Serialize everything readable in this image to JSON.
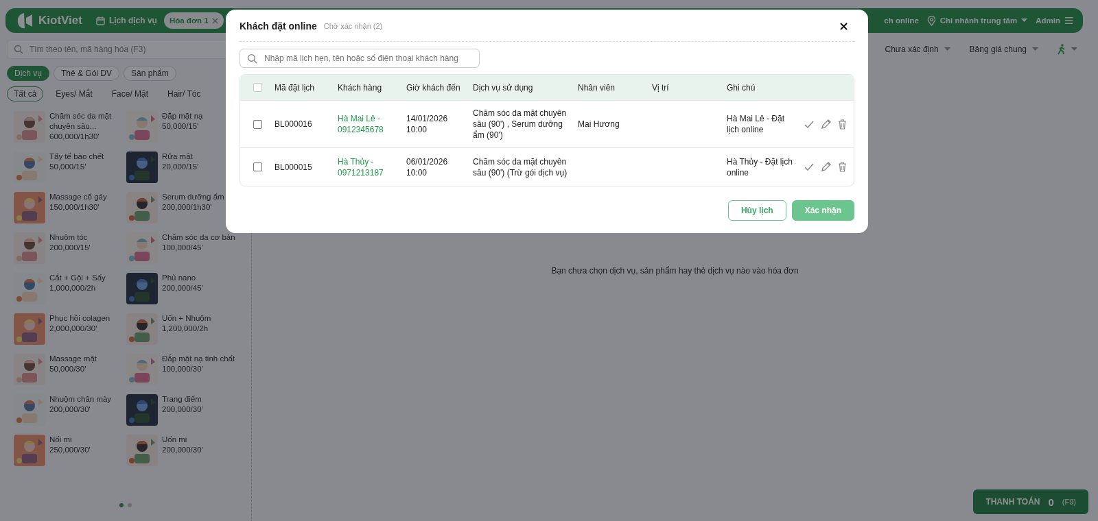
{
  "header": {
    "logo": "KiotViet",
    "nav": [
      {
        "label": "Lịch dịch vụ",
        "kind": "calendar",
        "selected": false
      },
      {
        "label": "Hóa đơn 1",
        "kind": "tab",
        "selected": true
      }
    ],
    "right": [
      {
        "label": "ch online",
        "kind": "text"
      },
      {
        "label": "Chi nhánh trung tâm",
        "kind": "branch"
      },
      {
        "label": "Admin",
        "kind": "menu"
      }
    ]
  },
  "search": {
    "placeholder": "Tìm theo tên, mã hàng hóa (F3)"
  },
  "categories": [
    {
      "label": "Dịch vụ",
      "selected": true
    },
    {
      "label": "Thẻ & Gói DV",
      "selected": false
    },
    {
      "label": "Sản phẩm",
      "selected": false
    }
  ],
  "filters": [
    {
      "label": "Tất cả",
      "selected": true
    },
    {
      "label": "Eyes/ Mắt",
      "selected": false
    },
    {
      "label": "Face/ Mặt",
      "selected": false
    },
    {
      "label": "Hair/ Tóc",
      "selected": false
    }
  ],
  "products": [
    {
      "name": "Chăm sóc da mặt chuyên sâu...",
      "price": "600,000/1h30'"
    },
    {
      "name": "Đắp mặt nạ",
      "price": "50,000/15'"
    },
    {
      "name": "Tẩy tế bào chết",
      "price": "50,000/15'"
    },
    {
      "name": "Rửa mặt",
      "price": "20,000/15'"
    },
    {
      "name": "Massage cổ gáy",
      "price": "150,000/1h30'"
    },
    {
      "name": "Serum dưỡng ẩm",
      "price": "200,000/1h30'"
    },
    {
      "name": "Nhuộm tóc",
      "price": "200,000/15'"
    },
    {
      "name": "Chăm sóc da cơ bản",
      "price": "100,000/45'"
    },
    {
      "name": "Cắt + Gội + Sấy",
      "price": "1,000,000/2h"
    },
    {
      "name": "Phủ nano",
      "price": "200,000/45'"
    },
    {
      "name": "Phục hồi colagen",
      "price": "2,000,000/30'"
    },
    {
      "name": "Uốn + Nhuộm",
      "price": "1,200,000/2h"
    },
    {
      "name": "Massage mặt",
      "price": "50,000/30'"
    },
    {
      "name": "Đắp mặt nạ tinh chất",
      "price": "100,000/30'"
    },
    {
      "name": "Nhuộm chân mày",
      "price": "200,000/30'"
    },
    {
      "name": "Trang điểm",
      "price": "200,000/30'"
    },
    {
      "name": "Nối mi",
      "price": "250,000/30'"
    },
    {
      "name": "Uốn mi",
      "price": "200,000/30'"
    }
  ],
  "pages": [
    {
      "selected": true
    },
    {
      "selected": false
    }
  ],
  "toolbar": [
    {
      "label": "Chưa xác định",
      "kind": "text"
    },
    {
      "label": "Bảng giá chung",
      "kind": "text"
    },
    {
      "kind": "walk"
    }
  ],
  "empty_message": "Bạn chưa chọn dịch vụ, sản phẩm hay thẻ dịch vụ nào vào hóa đơn",
  "pay_button": {
    "label": "THANH TOÁN",
    "amount": "0",
    "shortcut": "(F9)"
  },
  "modal": {
    "title": "Khách đặt online",
    "subtitle": "Chờ xác nhận (2)",
    "search": {
      "placeholder": "Nhập mã lịch hẹn, tên hoặc số điện thoại khách hàng"
    },
    "table": {
      "all_checked": false,
      "columns": [
        "Mã đặt lịch",
        "Khách hàng",
        "Giờ khách đến",
        "Dịch vụ sử dụng",
        "Nhân viên",
        "Vị trí",
        "Ghi chú"
      ],
      "rows": [
        {
          "checked": false,
          "code": "BL000016",
          "customer": "Hà Mai Lê - 0912345678",
          "time": "14/01/2026 10:00",
          "services": "Chăm sóc da mặt chuyên sâu (90') , Serum dưỡng ẩm (90')",
          "staff": "Mai Hương",
          "note": "Hà Mai Lê - Đặt lịch online"
        },
        {
          "checked": false,
          "code": "BL000015",
          "customer": "Hà Thủy - 0971213187",
          "time": "06/01/2026 10:00",
          "services": "Chăm sóc da mặt chuyên sâu (90') (Trừ gói dịch vụ)",
          "note": "Hà Thủy - Đặt lịch online"
        }
      ]
    },
    "buttons": [
      {
        "label": "Hủy lịch",
        "kind": "secondary"
      },
      {
        "label": "Xác nhận",
        "kind": "primary"
      }
    ]
  }
}
